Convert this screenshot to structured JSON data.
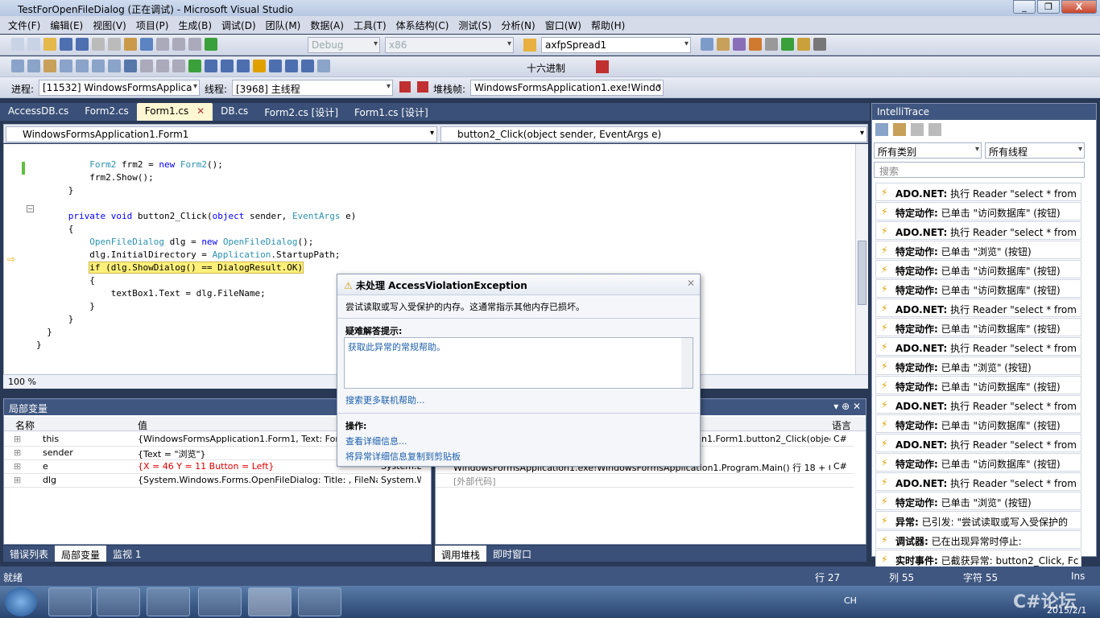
{
  "window": {
    "title": "TestForOpenFileDialog (正在调试) - Microsoft Visual Studio",
    "buttons": [
      "_",
      "❐",
      "X"
    ]
  },
  "menu": [
    "文件(F)",
    "编辑(E)",
    "视图(V)",
    "项目(P)",
    "生成(B)",
    "调试(D)",
    "团队(M)",
    "数据(A)",
    "工具(T)",
    "体系结构(C)",
    "测试(S)",
    "分析(N)",
    "窗口(W)",
    "帮助(H)"
  ],
  "toolbar1": {
    "config": "Debug",
    "platform": "x86",
    "find": "axfpSpread1"
  },
  "toolbar2": {
    "hex_label": "十六进制"
  },
  "toolbar3": {
    "process_label": "进程:",
    "process": "[11532] WindowsFormsApplica",
    "thread_label": "线程:",
    "thread": "[3968] 主线程",
    "stack_label": "堆栈帧:",
    "stack": "WindowsFormsApplication1.exe!Windo"
  },
  "tabs": [
    "AccessDB.cs",
    "Form2.cs",
    "Form1.cs",
    "DB.cs",
    "Form2.cs [设计]",
    "Form1.cs [设计]"
  ],
  "navbar": {
    "class": "WindowsFormsApplication1.Form1",
    "member": "button2_Click(object sender, EventArgs e)"
  },
  "code": {
    "l1a": "Form2",
    "l1b": " frm2 = ",
    "l1c": "new",
    "l1d": " ",
    "l1e": "Form2",
    "l1f": "();",
    "l2": "frm2.Show();",
    "l3": "}",
    "l4a": "private",
    "l4b": " ",
    "l4c": "void",
    "l4d": " button2_Click(",
    "l4e": "object",
    "l4f": " sender, ",
    "l4g": "EventArgs",
    "l4h": " e)",
    "l5": "{",
    "l6a": "OpenFileDialog",
    "l6b": " dlg = ",
    "l6c": "new",
    "l6d": " ",
    "l6e": "OpenFileDialog",
    "l6f": "();",
    "l7a": "dlg.InitialDirectory = ",
    "l7b": "Application",
    "l7c": ".StartupPath;",
    "l8": "if (dlg.ShowDialog() == DialogResult.OK)",
    "l9": "{",
    "l10": "textBox1.Text = dlg.FileName;",
    "l11": "}",
    "l12": "}",
    "l13": "}",
    "l14": "}"
  },
  "zoom": "100 %",
  "locals": {
    "title": "局部变量",
    "col_name": "名称",
    "col_value": "值",
    "rows": [
      {
        "name": "this",
        "value": "{WindowsFormsApplication1.Form1, Text: Form",
        "type": ""
      },
      {
        "name": "sender",
        "value": "{Text = \"浏览\"}",
        "type": ""
      },
      {
        "name": "e",
        "value": "{X = 46 Y = 11 Button = Left}",
        "type": "System.E"
      },
      {
        "name": "dlg",
        "value": "{System.Windows.Forms.OpenFileDialog: Title: , FileNam",
        "type": "System.W"
      }
    ]
  },
  "callstack": {
    "col_lang": "语言",
    "rows": [
      {
        "text": "n1.Form1.button2_Click(objec",
        "lang": "C#"
      },
      {
        "text": "WindowsFormsApplication1.exe!WindowsFormsApplication1.Program.Main() 行 18 + 0x1",
        "lang": "C#"
      },
      {
        "text": "[外部代码]",
        "lang": ""
      }
    ]
  },
  "bottom_tabs_left": [
    "错误列表",
    "局部变量",
    "监视 1"
  ],
  "bottom_tabs_right": [
    "调用堆栈",
    "即时窗口"
  ],
  "exception": {
    "title": "未处理 AccessViolationException",
    "message": "尝试读取或写入受保护的内存。这通常指示其他内存已损坏。",
    "tips_label": "疑难解答提示:",
    "tip": "获取此异常的常规帮助。",
    "more_help": "搜索更多联机帮助...",
    "actions_label": "操作:",
    "action1": "查看详细信息...",
    "action2": "将异常详细信息复制到剪贴板"
  },
  "intellitrace": {
    "title": "IntelliTrace",
    "category": "所有类别",
    "thread": "所有线程",
    "search_placeholder": "搜索",
    "items": [
      {
        "bold": "ADO.NET:",
        "text": " 执行 Reader \"select * from"
      },
      {
        "bold": "特定动作:",
        "text": " 已单击 \"访问数据库\" (按钮)"
      },
      {
        "bold": "ADO.NET:",
        "text": " 执行 Reader \"select * from"
      },
      {
        "bold": "特定动作:",
        "text": " 已单击 \"浏览\" (按钮)"
      },
      {
        "bold": "特定动作:",
        "text": " 已单击 \"访问数据库\" (按钮)"
      },
      {
        "bold": "特定动作:",
        "text": " 已单击 \"访问数据库\" (按钮)"
      },
      {
        "bold": "ADO.NET:",
        "text": " 执行 Reader \"select * from"
      },
      {
        "bold": "特定动作:",
        "text": " 已单击 \"访问数据库\" (按钮)"
      },
      {
        "bold": "ADO.NET:",
        "text": " 执行 Reader \"select * from"
      },
      {
        "bold": "特定动作:",
        "text": " 已单击 \"浏览\" (按钮)"
      },
      {
        "bold": "特定动作:",
        "text": " 已单击 \"访问数据库\" (按钮)"
      },
      {
        "bold": "ADO.NET:",
        "text": " 执行 Reader \"select * from"
      },
      {
        "bold": "特定动作:",
        "text": " 已单击 \"访问数据库\" (按钮)"
      },
      {
        "bold": "ADO.NET:",
        "text": " 执行 Reader \"select * from"
      },
      {
        "bold": "特定动作:",
        "text": " 已单击 \"访问数据库\" (按钮)"
      },
      {
        "bold": "ADO.NET:",
        "text": " 执行 Reader \"select * from"
      },
      {
        "bold": "特定动作:",
        "text": " 已单击 \"浏览\" (按钮)"
      },
      {
        "bold": "异常:",
        "text": " 已引发: \"尝试读取或写入受保护的"
      },
      {
        "bold": "调试器:",
        "text": " 已在出现异常时停止:"
      },
      {
        "bold": "实时事件:",
        "text": " 已截获异常: button2_Click, Fc"
      }
    ]
  },
  "status": {
    "ready": "就绪",
    "line": "行 27",
    "col": "列 55",
    "ch": "字符 55",
    "ins": "Ins"
  },
  "tray": {
    "lang": "CH",
    "date": "2015/2/1",
    "watermark": "C#论坛"
  },
  "colors": {
    "accent": "#3f5680",
    "tab_active": "#fff7d2",
    "highlight": "#fff07a",
    "link": "#1b5eab"
  }
}
